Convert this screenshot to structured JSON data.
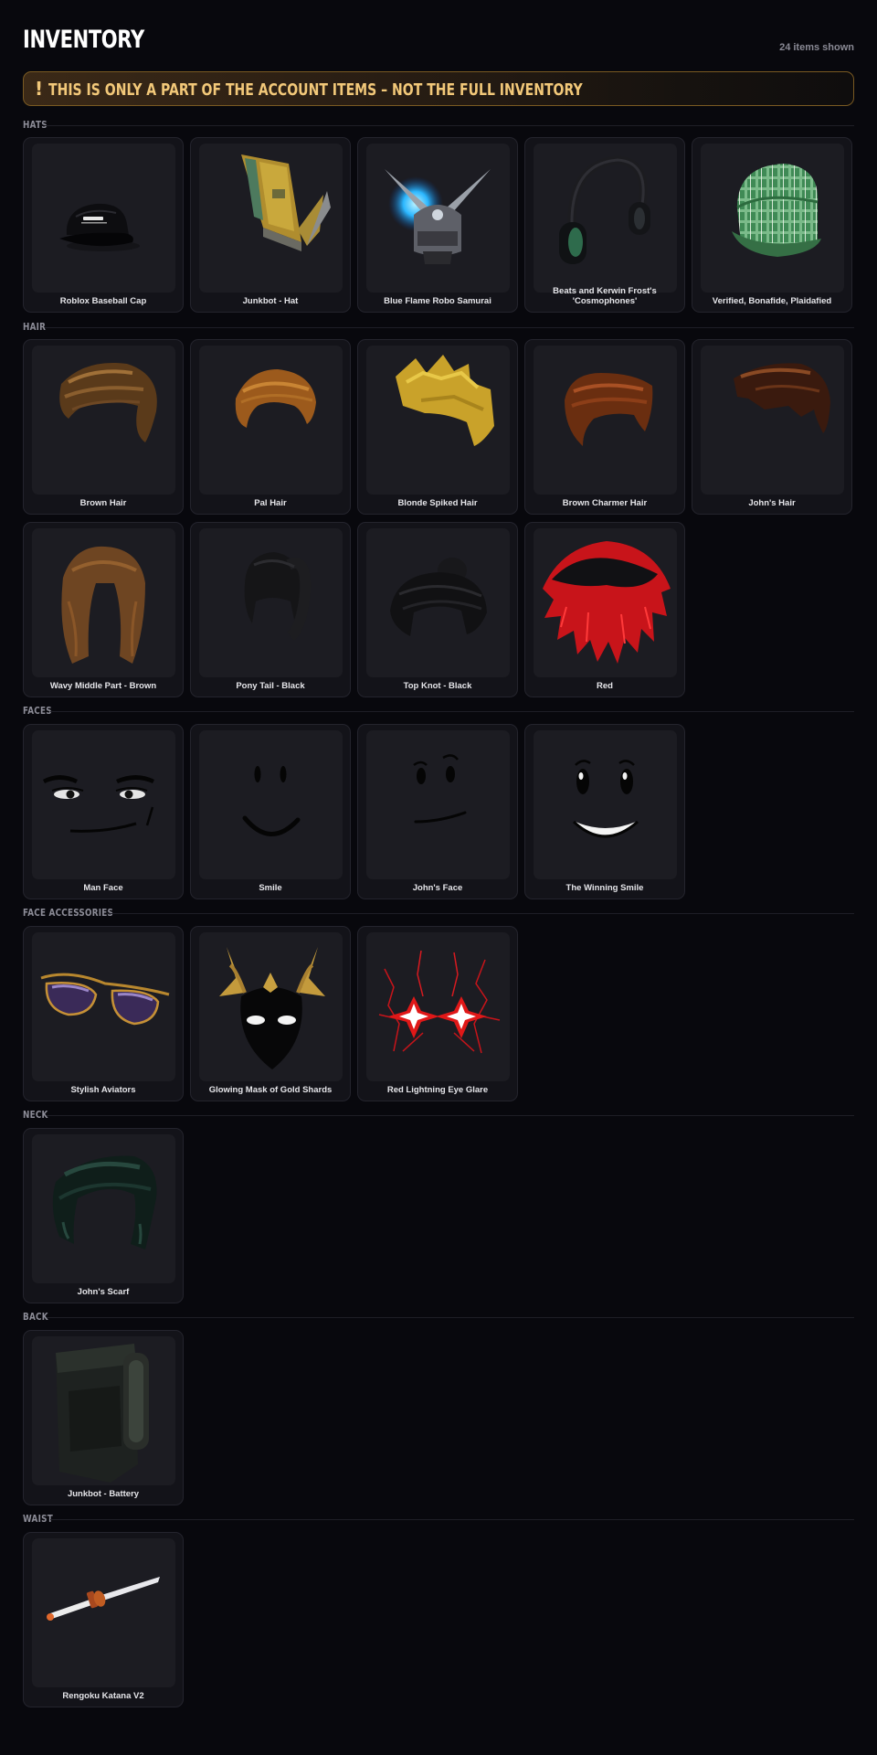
{
  "header": {
    "title": "INVENTORY",
    "count_text": "24 items shown"
  },
  "banner": {
    "icon": "!",
    "icon_name": "exclamation-icon",
    "text": "THIS IS ONLY A PART OF THE ACCOUNT ITEMS – NOT THE FULL INVENTORY"
  },
  "colors": {
    "background": "#08080d",
    "card": "#131319",
    "thumb": "#1c1c22",
    "banner_accent": "#f2c879",
    "section_title": "#8d8d98"
  },
  "sections": {
    "hats": {
      "title": "HATS",
      "items": [
        {
          "name": "Roblox Baseball Cap"
        },
        {
          "name": "Junkbot - Hat"
        },
        {
          "name": "Blue Flame Robo Samurai"
        },
        {
          "name": "Beats and Kerwin Frost's\n'Cosmophones'"
        },
        {
          "name": "Verified, Bonafide, Plaidafied"
        }
      ]
    },
    "hair": {
      "title": "HAIR",
      "items": [
        {
          "name": "Brown Hair"
        },
        {
          "name": "Pal Hair"
        },
        {
          "name": "Blonde Spiked Hair"
        },
        {
          "name": "Brown Charmer Hair"
        },
        {
          "name": "John's Hair"
        },
        {
          "name": "Wavy Middle Part - Brown"
        },
        {
          "name": "Pony Tail - Black"
        },
        {
          "name": "Top Knot - Black"
        },
        {
          "name": "Red"
        }
      ]
    },
    "faces": {
      "title": "FACES",
      "items": [
        {
          "name": "Man Face"
        },
        {
          "name": "Smile"
        },
        {
          "name": "John's Face"
        },
        {
          "name": "The Winning Smile"
        }
      ]
    },
    "face_accessories": {
      "title": "FACE ACCESSORIES",
      "items": [
        {
          "name": "Stylish Aviators"
        },
        {
          "name": "Glowing Mask of Gold Shards"
        },
        {
          "name": "Red Lightning Eye Glare"
        }
      ]
    },
    "neck": {
      "title": "NECK",
      "items": [
        {
          "name": "John's Scarf"
        }
      ]
    },
    "back": {
      "title": "BACK",
      "items": [
        {
          "name": "Junkbot - Battery"
        }
      ]
    },
    "waist": {
      "title": "WAIST",
      "items": [
        {
          "name": "Rengoku Katana V2"
        }
      ]
    }
  }
}
